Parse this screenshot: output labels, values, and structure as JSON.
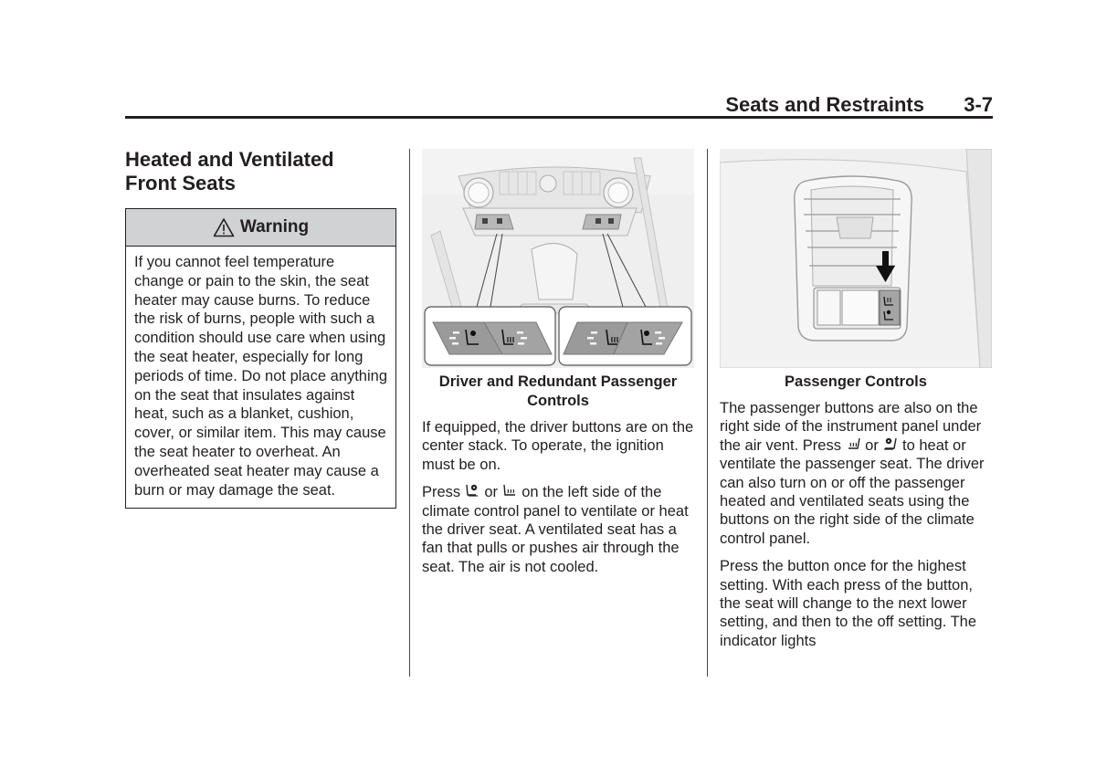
{
  "header": {
    "section_title": "Seats and Restraints",
    "page_number": "3-7"
  },
  "column1": {
    "title_line1": "Heated and Ventilated",
    "title_line2": "Front Seats",
    "warning": {
      "icon": "warning-triangle-icon",
      "label": "Warning",
      "text": "If you cannot feel temperature change or pain to the skin, the seat heater may cause burns. To reduce the risk of burns, people with such a condition should use care when using the seat heater, especially for long periods of time. Do not place anything on the seat that insulates against heat, such as a blanket, cushion, cover, or similar item. This may cause the seat heater to overheat. An overheated seat heater may cause a burn or may damage the seat."
    }
  },
  "column2": {
    "figure_caption": "Driver and Redundant Passenger Controls",
    "para1": "If equipped, the driver buttons are on the center stack. To operate, the ignition must be on.",
    "para2": {
      "prefix": "Press ",
      "icon1": "ventilated-seat-icon",
      "middle": " or ",
      "icon2": "heated-seat-icon",
      "suffix": " on the left side of the climate control panel to ventilate or heat the driver seat. A ventilated seat has a fan that pulls or pushes air through the seat. The air is not cooled."
    }
  },
  "column3": {
    "figure_caption": "Passenger Controls",
    "para1": {
      "prefix": "The passenger buttons are also on the right side of the instrument panel under the air vent. Press ",
      "icon1": "heated-seat-icon",
      "middle": " or ",
      "icon2": "ventilated-seat-icon",
      "suffix": " to heat or ventilate the passenger seat. The driver can also turn on or off the passenger heated and ventilated seats using the buttons on the right side of the climate control panel."
    },
    "para2": "Press the button once for the highest setting. With each press of the button, the seat will change to the next lower setting, and then to the off setting. The indicator lights"
  }
}
